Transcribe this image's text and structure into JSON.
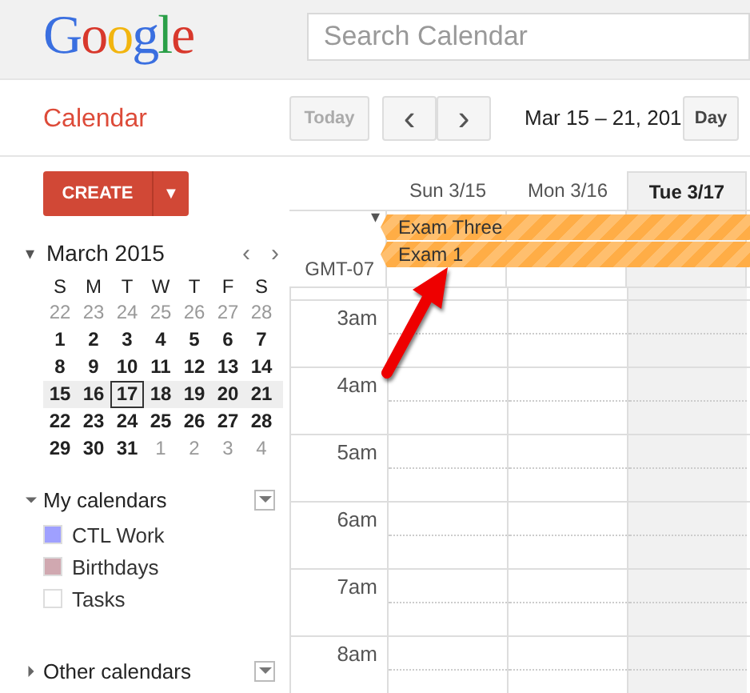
{
  "header": {
    "logo": "Google",
    "search": {
      "placeholder": "Search Calendar"
    }
  },
  "toolbar": {
    "title": "Calendar",
    "today": "Today",
    "prev": "‹",
    "next": "›",
    "date_range": "Mar 15 – 21, 201",
    "views": [
      {
        "label": "Day",
        "selected": false
      }
    ]
  },
  "sidebar": {
    "create": "CREATE",
    "create_menu": "▼",
    "mini_calendar": {
      "caret": "▾",
      "month": "March 2015",
      "prev": "‹",
      "next": "›",
      "weekdays": [
        "S",
        "M",
        "T",
        "W",
        "T",
        "F",
        "S"
      ],
      "weeks": [
        {
          "highlighted": false,
          "days": [
            {
              "d": "22",
              "muted": true,
              "selected": false
            },
            {
              "d": "23",
              "muted": true,
              "selected": false
            },
            {
              "d": "24",
              "muted": true,
              "selected": false
            },
            {
              "d": "25",
              "muted": true,
              "selected": false
            },
            {
              "d": "26",
              "muted": true,
              "selected": false
            },
            {
              "d": "27",
              "muted": true,
              "selected": false
            },
            {
              "d": "28",
              "muted": true,
              "selected": false
            }
          ]
        },
        {
          "highlighted": false,
          "days": [
            {
              "d": "1",
              "muted": false,
              "selected": false
            },
            {
              "d": "2",
              "muted": false,
              "selected": false
            },
            {
              "d": "3",
              "muted": false,
              "selected": false
            },
            {
              "d": "4",
              "muted": false,
              "selected": false
            },
            {
              "d": "5",
              "muted": false,
              "selected": false
            },
            {
              "d": "6",
              "muted": false,
              "selected": false
            },
            {
              "d": "7",
              "muted": false,
              "selected": false
            }
          ]
        },
        {
          "highlighted": false,
          "days": [
            {
              "d": "8",
              "muted": false,
              "selected": false
            },
            {
              "d": "9",
              "muted": false,
              "selected": false
            },
            {
              "d": "10",
              "muted": false,
              "selected": false
            },
            {
              "d": "11",
              "muted": false,
              "selected": false
            },
            {
              "d": "12",
              "muted": false,
              "selected": false
            },
            {
              "d": "13",
              "muted": false,
              "selected": false
            },
            {
              "d": "14",
              "muted": false,
              "selected": false
            }
          ]
        },
        {
          "highlighted": true,
          "days": [
            {
              "d": "15",
              "muted": false,
              "selected": false
            },
            {
              "d": "16",
              "muted": false,
              "selected": false
            },
            {
              "d": "17",
              "muted": false,
              "selected": true
            },
            {
              "d": "18",
              "muted": false,
              "selected": false
            },
            {
              "d": "19",
              "muted": false,
              "selected": false
            },
            {
              "d": "20",
              "muted": false,
              "selected": false
            },
            {
              "d": "21",
              "muted": false,
              "selected": false
            }
          ]
        },
        {
          "highlighted": false,
          "days": [
            {
              "d": "22",
              "muted": false,
              "selected": false
            },
            {
              "d": "23",
              "muted": false,
              "selected": false
            },
            {
              "d": "24",
              "muted": false,
              "selected": false
            },
            {
              "d": "25",
              "muted": false,
              "selected": false
            },
            {
              "d": "26",
              "muted": false,
              "selected": false
            },
            {
              "d": "27",
              "muted": false,
              "selected": false
            },
            {
              "d": "28",
              "muted": false,
              "selected": false
            }
          ]
        },
        {
          "highlighted": false,
          "days": [
            {
              "d": "29",
              "muted": false,
              "selected": false
            },
            {
              "d": "30",
              "muted": false,
              "selected": false
            },
            {
              "d": "31",
              "muted": false,
              "selected": false
            },
            {
              "d": "1",
              "muted": true,
              "selected": false
            },
            {
              "d": "2",
              "muted": true,
              "selected": false
            },
            {
              "d": "3",
              "muted": true,
              "selected": false
            },
            {
              "d": "4",
              "muted": true,
              "selected": false
            }
          ]
        }
      ]
    },
    "sections": [
      {
        "title": "My calendars",
        "expanded": true,
        "calendars": [
          {
            "name": "CTL Work",
            "color": "#9fa0ff"
          },
          {
            "name": "Birthdays",
            "color": "#d0a8b0"
          },
          {
            "name": "Tasks",
            "color": "#ffffff"
          }
        ]
      },
      {
        "title": "Other calendars",
        "expanded": false
      }
    ]
  },
  "week": {
    "allday_caret": "▾",
    "timezone": "GMT-07",
    "days": [
      {
        "label": "Sun 3/15",
        "selected": false
      },
      {
        "label": "Mon 3/16",
        "selected": false
      },
      {
        "label": "Tue 3/17",
        "selected": true
      }
    ],
    "allday_events": [
      {
        "title": "Exam Three"
      },
      {
        "title": "Exam 1"
      }
    ],
    "hours": [
      "3am",
      "4am",
      "5am",
      "6am",
      "7am",
      "8am"
    ]
  }
}
